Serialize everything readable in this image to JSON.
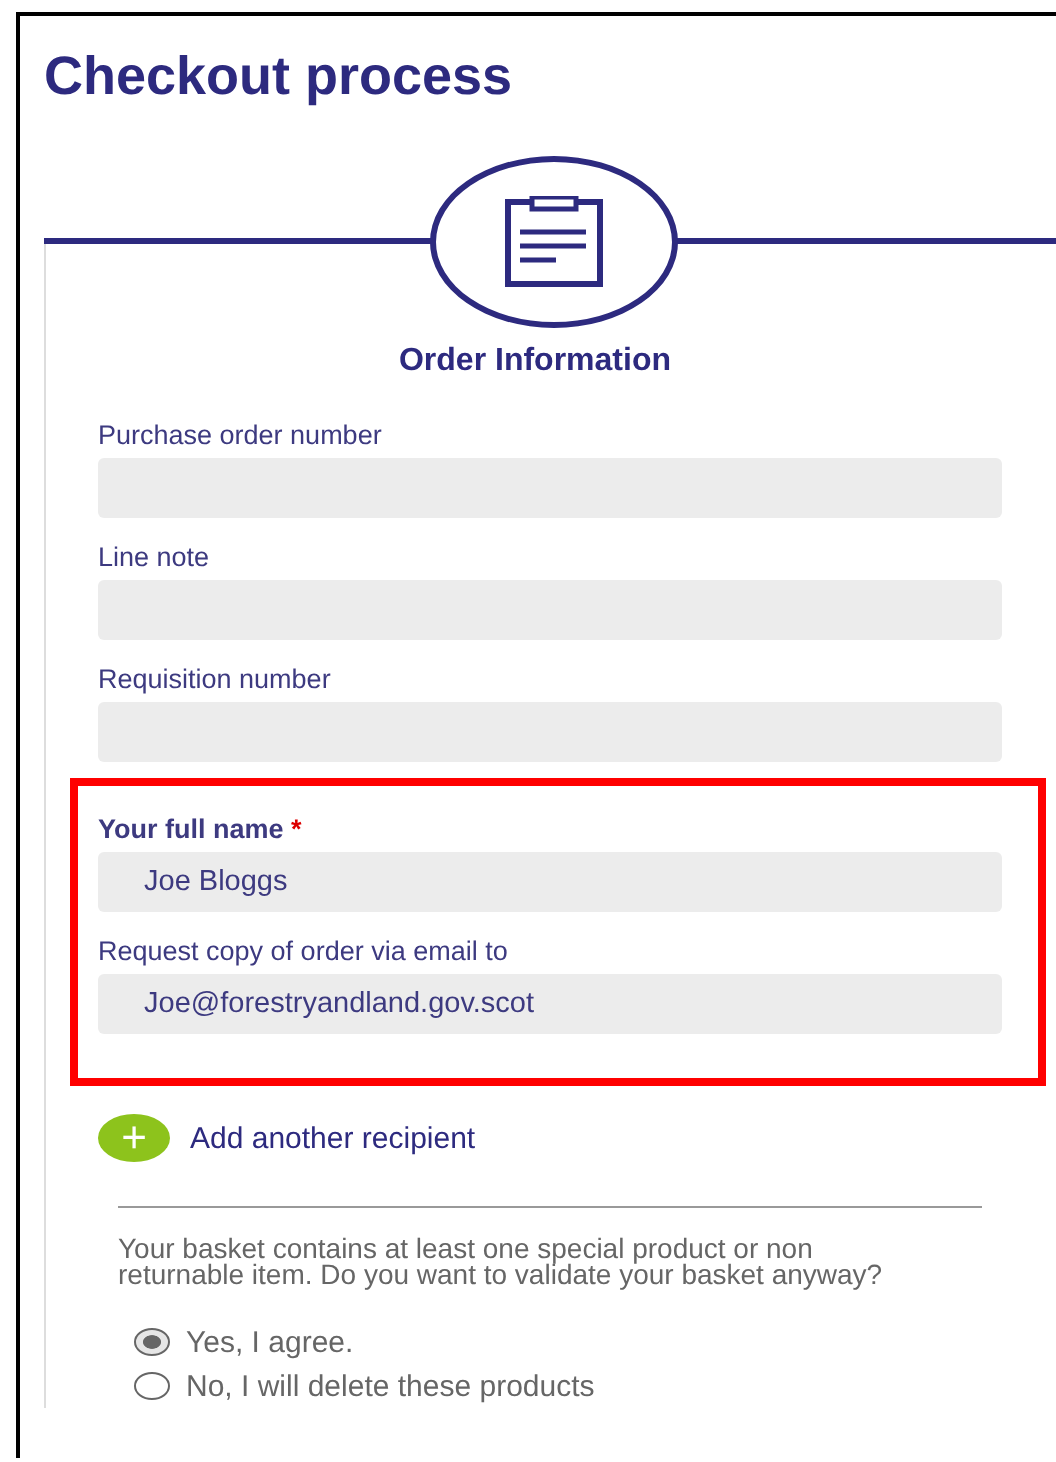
{
  "title": "Checkout process",
  "step": {
    "label": "Order Information"
  },
  "fields": [
    {
      "label": "Purchase order number"
    },
    {
      "label": "Line note"
    },
    {
      "label": "Requisition number"
    }
  ],
  "highlighted_fields": [
    {
      "label": "Your full name",
      "value": "Joe Bloggs",
      "required": true,
      "required_mark": "*"
    },
    {
      "label": "Request copy of order via email to",
      "value": "Joe@forestryandland.gov.scot",
      "required": false
    }
  ],
  "add_recipient": {
    "icon": "+",
    "label": "Add another recipient"
  },
  "notice": "Your basket contains at least one special product or non returnable item. Do you want to validate your basket anyway?",
  "options": [
    {
      "label": "Yes, I agree.",
      "selected": true
    },
    {
      "label": "No, I will delete these products",
      "selected": false
    }
  ]
}
